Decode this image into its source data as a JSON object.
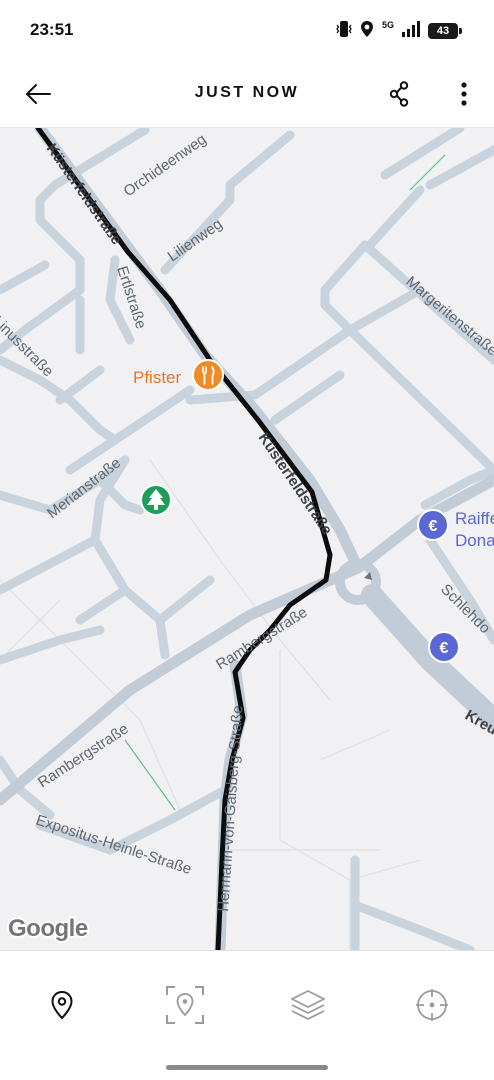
{
  "status_bar": {
    "time": "23:51",
    "network": "5G",
    "battery": "43",
    "icons": [
      "vibrate-icon",
      "location-icon",
      "signal-icon",
      "battery-icon"
    ]
  },
  "app_bar": {
    "title": "JUST NOW",
    "icons": [
      "back-arrow-icon",
      "share-icon",
      "more-vert-icon"
    ]
  },
  "map": {
    "streets": {
      "kuesterfeldstrasse": "Küsterfeldstraße",
      "orchideenweg": "Orchideenweg",
      "lilienweg": "Lilienweg",
      "ertlstrasse": "Ertlstraße",
      "margeritenstrasse": "Margeritenstraße",
      "linusstrasse": "Linusstraße",
      "merianstrasse": "Merianstraße",
      "rambergstrasse": "Rambergstraße",
      "schlehdorn": "Schlehdo",
      "kreuz": "Kreu",
      "hermann_von_gaisberg": "Hermann-von-Gaisberg-Straße",
      "expositus_heinle": "Expositus-Heinle-Straße"
    },
    "pois": {
      "restaurant": "Pfister",
      "bank": "Raiffe",
      "bank_line2": "Dona"
    },
    "attribution": "Google",
    "colors": {
      "background": "#f1f1f3",
      "road": "#c9d3dd",
      "road_major": "#c2ccd7",
      "track": "#111111",
      "restaurant_pin": "#f08a24",
      "bank_pin": "#5c67d6",
      "park_pin": "#1e9e5a"
    }
  },
  "bottom_nav": {
    "icons": [
      "pin-icon",
      "focus-pin-icon",
      "layers-icon",
      "my-location-icon"
    ]
  }
}
